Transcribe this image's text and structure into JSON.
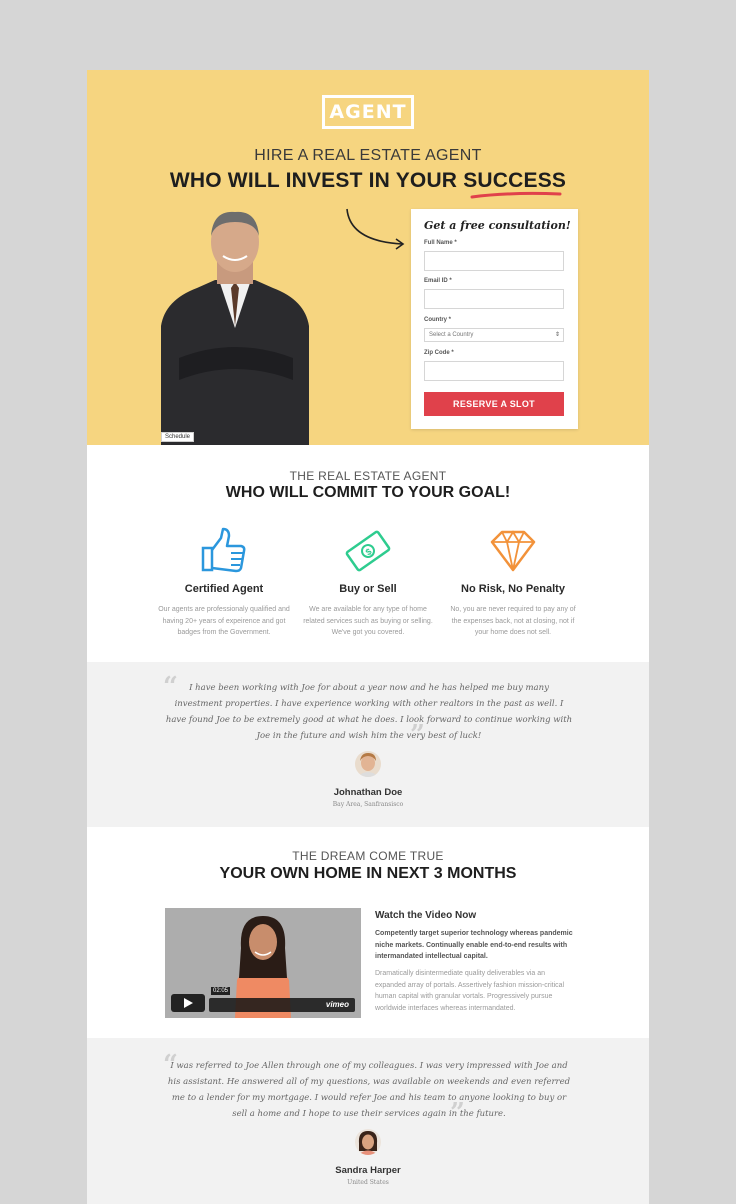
{
  "hero": {
    "logo": "AGENT",
    "subtitle": "HIRE A REAL ESTATE AGENT",
    "title": "WHO WILL INVEST IN YOUR SUCCESS",
    "schedule_tag": "Schedule",
    "background": "#f6d580"
  },
  "form": {
    "title": "Get a free consultation!",
    "full_name_label": "Full Name *",
    "email_label": "Email ID *",
    "country_label": "Country *",
    "country_value": "Select a Country",
    "zip_label": "Zip Code *",
    "submit_label": "RESERVE A SLOT",
    "submit_color": "#e0414b"
  },
  "features_section": {
    "subtitle": "THE REAL ESTATE AGENT",
    "title": "WHO WILL COMMIT TO YOUR GOAL!",
    "items": [
      {
        "icon": "thumbs-up-icon",
        "title": "Certified Agent",
        "desc": "Our agents are professionaly qualified and having 20+ years of expeirence and got badges from the Government."
      },
      {
        "icon": "money-icon",
        "title": "Buy or Sell",
        "desc": "We are available for any type of home related services such as buying or selling. We've got you covered."
      },
      {
        "icon": "diamond-icon",
        "title": "No Risk, No Penalty",
        "desc": "No, you are never required to pay any of the expenses back, not at closing, not if your home does not sell."
      }
    ]
  },
  "testimonial1": {
    "quote": "I have been working with Joe for about a year now and he has helped me buy many investment properties. I have experience working with other realtors in the past as well. I have found Joe to be extremely good at what he does. I look forward to continue working with Joe in the future and wish him the very best of luck!",
    "name": "Johnathan Doe",
    "location": "Bay Area, Sanfransisco"
  },
  "video_section": {
    "subtitle": "THE DREAM COME TRUE",
    "title": "YOUR OWN HOME IN NEXT 3 MONTHS",
    "timecode": "02:05",
    "brand": "vimeo",
    "heading": "Watch the Video Now",
    "p1": "Competently target superior technology whereas pandemic niche markets. Continually enable end-to-end results with intermandated intellectual capital.",
    "p2": "Dramatically disintermediate quality deliverables via an expanded array of portals. Assertively fashion mission-critical human capital with granular vortals. Progressively pursue worldwide interfaces whereas intermandated."
  },
  "testimonial2": {
    "quote": "I was referred to Joe Allen through one of my colleagues. I was very impressed with Joe and his assistant. He answered all of my questions, was available on weekends and even referred me to a lender for my mortgage. I would refer Joe and his team to anyone looking to buy or sell a home and I hope to use their services again in the future.",
    "name": "Sandra Harper",
    "location": "United States"
  }
}
